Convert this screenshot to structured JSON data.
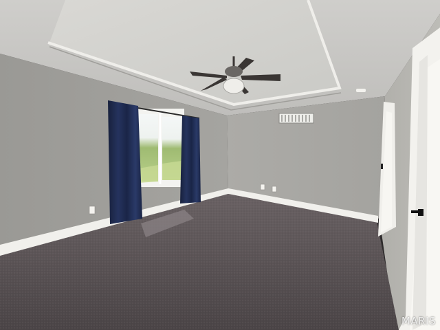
{
  "image": {
    "description_tag": "empty-bedroom-photo",
    "watermark": "MARIS"
  },
  "palette": {
    "wall_left": "#9b9a96",
    "wall_back": "#a9a8a4",
    "wall_right": "#b4b3ae",
    "ceiling": "#c9c8c4",
    "tray": "#d4d3cf",
    "carpet": "#5c5456",
    "curtain": "#1d2a4f",
    "trim": "#f1f0ec",
    "fan": "#3a3634"
  }
}
